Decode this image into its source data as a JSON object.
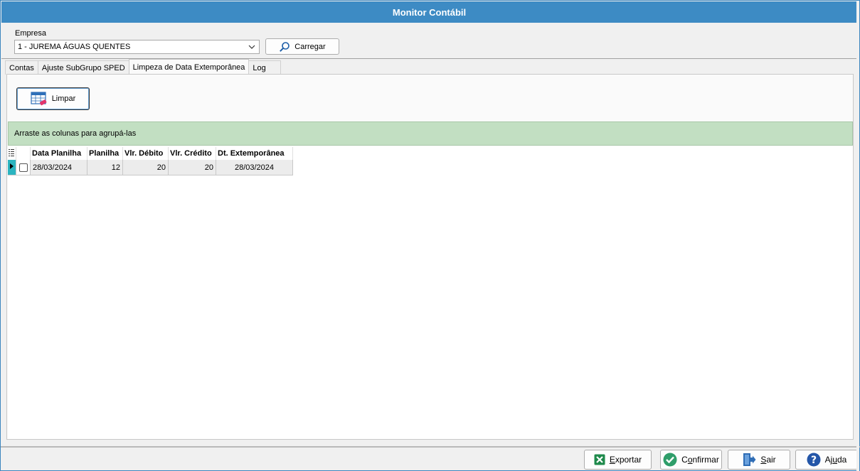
{
  "window": {
    "title": "Monitor Contábil"
  },
  "empresa": {
    "label": "Empresa",
    "selected": "1 - JUREMA ÁGUAS QUENTES",
    "load_label": "Carregar"
  },
  "tabs": [
    {
      "label": "Contas"
    },
    {
      "label": "Ajuste SubGrupo SPED"
    },
    {
      "label": "Limpeza de Data Extemporânea"
    },
    {
      "label": "Log"
    }
  ],
  "toolbar": {
    "limpar_label": "Limpar"
  },
  "grid": {
    "group_hint": "Arraste as colunas para agrupá-las",
    "columns": [
      "Data Planilha",
      "Planilha",
      "Vlr. Débito",
      "Vlr. Crédito",
      "Dt. Extemporânea"
    ],
    "rows": [
      {
        "data_planilha": "28/03/2024",
        "planilha": "12",
        "vlr_debito": "20",
        "vlr_credito": "20",
        "dt_extemporanea": "28/03/2024"
      }
    ]
  },
  "footer": {
    "exportar_pre": "",
    "exportar_u": "E",
    "exportar_post": "xportar",
    "confirmar_pre": "C",
    "confirmar_u": "o",
    "confirmar_post": "nfirmar",
    "sair_pre": "",
    "sair_u": "S",
    "sair_post": "air",
    "ajuda_pre": "Aj",
    "ajuda_u": "u",
    "ajuda_post": "da"
  },
  "colors": {
    "titlebar": "#3d8bc4",
    "group_band": "#c2dfc2",
    "row_indicator": "#2bb4c0"
  }
}
